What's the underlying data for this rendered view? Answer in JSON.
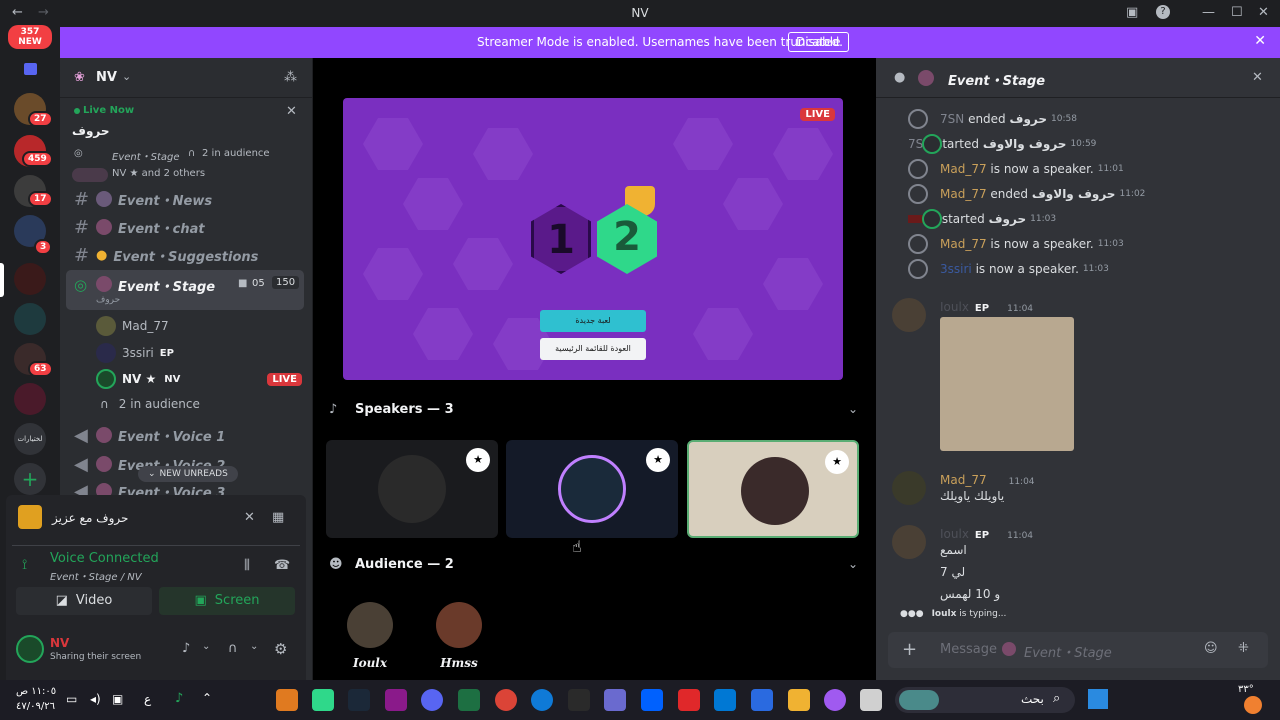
{
  "titlebar": {
    "title": "NV"
  },
  "guilds": {
    "top_badge_count": "357",
    "top_badge_new": "NEW",
    "badges": [
      "27",
      "459",
      "17",
      "3",
      "63"
    ],
    "text_icon": "لختيارات"
  },
  "banner": {
    "text": "Streamer Mode is enabled. Usernames have been truncated.",
    "button": "Disable"
  },
  "sidebar": {
    "server_name": "NV",
    "live_now": "Live Now",
    "live_title": "حروف",
    "live_channel": "Event・Stage",
    "live_audience": "2 in audience",
    "live_people": "NV ★ and 2 others",
    "channels": [
      {
        "type": "text",
        "name": "Event・News"
      },
      {
        "type": "text",
        "name": "Event・chat"
      },
      {
        "type": "text",
        "name": "Event・Suggestions"
      }
    ],
    "stage": {
      "name": "Event・Stage",
      "topic": "حروف",
      "video_count": "05",
      "count": "150"
    },
    "members": [
      {
        "name": "Mad_77",
        "tag": ""
      },
      {
        "name": "3ssiri",
        "tag": "EP"
      },
      {
        "name": "NV ★",
        "tag": "NV",
        "live": "LIVE"
      }
    ],
    "audience_label": "2 in audience",
    "voice_channels": [
      "Event・Voice 1",
      "Event・Voice 2",
      "Event・Voice 3"
    ],
    "new_unreads": "NEW UNREADS"
  },
  "voice_panel": {
    "activity": "حروف مع عزيز",
    "status": "Voice Connected",
    "channel": "Event・Stage / NV",
    "video_button": "Video",
    "screen_button": "Screen",
    "user_name": "NV",
    "user_status": "Sharing their screen"
  },
  "stage": {
    "live": "LIVE",
    "game_score_left": "1",
    "game_score_right": "2",
    "game_btn_new": "لعبة جديدة",
    "game_btn_menu": "العودة للقائمة الرئيسية",
    "speakers_header": "Speakers — 3",
    "audience_header": "Audience — 2",
    "audience": [
      "Ioulx",
      "Hmss"
    ]
  },
  "chat": {
    "title": "Event・Stage",
    "system": [
      {
        "user": "7SN",
        "action": "ended",
        "bold": "حروف",
        "time": "10:58"
      },
      {
        "user": "7SN",
        "action": "started",
        "bold": "حروف والاوف",
        "time": "10:59"
      },
      {
        "user": "Mad_77",
        "action": "is now a speaker.",
        "bold": "",
        "time": "11:01"
      },
      {
        "user": "Mad_77",
        "action": "ended",
        "bold": "حروف والاوف",
        "time": "11:02"
      },
      {
        "user": "",
        "action": "started",
        "bold": "حروف",
        "time": "11:03"
      },
      {
        "user": "Mad_77",
        "action": "is now a speaker.",
        "bold": "",
        "time": "11:03"
      },
      {
        "user": "3ssiri",
        "action": "is now a speaker.",
        "bold": "",
        "time": "11:03"
      }
    ],
    "msg1": {
      "user": "Ioulx",
      "tag": "EP",
      "time": "11:04"
    },
    "msg2": {
      "user": "Mad_77",
      "time": "11:04",
      "text": "ياويلك ياويلك"
    },
    "msg3": {
      "user": "Ioulx",
      "tag": "EP",
      "time": "11:04",
      "lines": [
        "اسمع",
        "7 لي",
        "و 10 لهمس"
      ]
    },
    "typing_user": "Ioulx",
    "typing": "is typing...",
    "input_placeholder": "Message",
    "input_channel": "Event・Stage"
  },
  "taskbar": {
    "time": "١١:٠٥ ص",
    "date": "٤٧/٠٩/٢٦",
    "lang": "ع",
    "search": "بحث",
    "temp": "٣٣°"
  },
  "colors": {
    "banner": "#9147ff",
    "live": "#da373c",
    "connected": "#23a55a",
    "accent_speaker": "#5aad74"
  }
}
